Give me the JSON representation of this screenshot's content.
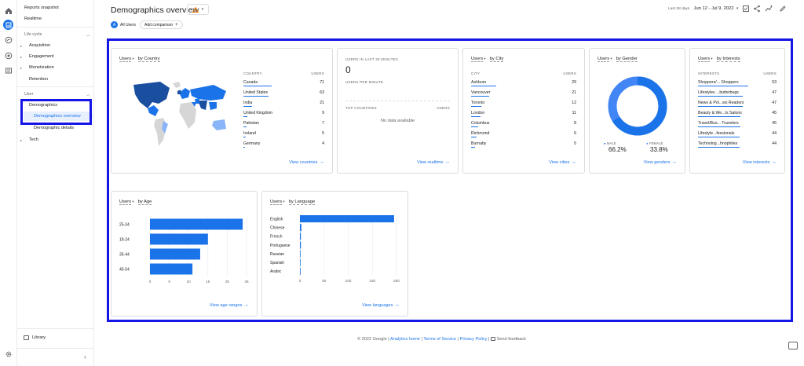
{
  "sidebar": {
    "reports_snapshot": "Reports snapshot",
    "realtime": "Realtime",
    "lifecycle_head": "Life cycle",
    "acquisition": "Acquisition",
    "engagement": "Engagement",
    "monetization": "Monetization",
    "retention": "Retention",
    "user_head": "User",
    "demographics": "Demographics",
    "demographics_overview": "Demographics overview",
    "demographic_details": "Demographic details",
    "tech": "Tech",
    "library": "Library"
  },
  "header": {
    "title": "Demographics overview",
    "date_label": "Last 28 days",
    "date_range": "Jun 12 - Jul 9, 2022",
    "all_users": "All Users",
    "all_users_avatar": "A",
    "add_comparison": "Add comparison"
  },
  "country_card": {
    "metric": "Users",
    "dimension": "by Country",
    "col_dim": "COUNTRY",
    "col_metric": "USERS",
    "rows": [
      {
        "label": "Canada",
        "value": "71",
        "share": 1.0
      },
      {
        "label": "United States",
        "value": "63",
        "share": 0.89
      },
      {
        "label": "India",
        "value": "21",
        "share": 0.3
      },
      {
        "label": "United Kingdom",
        "value": "9",
        "share": 0.13
      },
      {
        "label": "Pakistan",
        "value": "7",
        "share": 0.1
      },
      {
        "label": "Ireland",
        "value": "5",
        "share": 0.07
      },
      {
        "label": "Germany",
        "value": "4",
        "share": 0.06
      }
    ],
    "link": "View countries"
  },
  "realtime_card": {
    "head": "USERS IN LAST 30 MINUTES",
    "value": "0",
    "per_minute": "USERS PER MINUTE",
    "col_dim": "TOP COUNTRIES",
    "col_metric": "USERS",
    "empty": "No data available",
    "link": "View realtime"
  },
  "city_card": {
    "metric": "Users",
    "dimension": "by City",
    "col_dim": "CITY",
    "col_metric": "USERS",
    "rows": [
      {
        "label": "Ashburn",
        "value": "29",
        "share": 1.0
      },
      {
        "label": "Vancouver",
        "value": "21",
        "share": 0.72
      },
      {
        "label": "Toronto",
        "value": "12",
        "share": 0.41
      },
      {
        "label": "London",
        "value": "11",
        "share": 0.38
      },
      {
        "label": "Columbus",
        "value": "8",
        "share": 0.28
      },
      {
        "label": "Richmond",
        "value": "6",
        "share": 0.21
      },
      {
        "label": "Burnaby",
        "value": "5",
        "share": 0.17
      }
    ],
    "link": "View cities"
  },
  "gender_card": {
    "metric": "Users",
    "dimension": "by Gender",
    "male_label": "MALE",
    "male_value": "66.2%",
    "female_label": "FEMALE",
    "female_value": "33.8%",
    "male_color": "#1a73e8",
    "female_color": "#4285f4",
    "link": "View genders"
  },
  "interests_card": {
    "metric": "Users",
    "dimension": "by Interests",
    "col_dim": "INTERESTS",
    "col_metric": "USERS",
    "rows": [
      {
        "label": "Shoppers/... Shoppers",
        "value": "53",
        "share": 1.0
      },
      {
        "label": "Lifestyles ...butterbugs",
        "value": "47",
        "share": 0.89
      },
      {
        "label": "News & Pol...ws Readers",
        "value": "47",
        "share": 0.89
      },
      {
        "label": "Beauty & We...ts Salons",
        "value": "45",
        "share": 0.85
      },
      {
        "label": "Travel/Bus... Travelers",
        "value": "45",
        "share": 0.85
      },
      {
        "label": "Lifestyle...fessionals",
        "value": "44",
        "share": 0.83
      },
      {
        "label": "Technolog...hnophiles",
        "value": "44",
        "share": 0.83
      }
    ],
    "link": "View interests"
  },
  "age_card": {
    "metric": "Users",
    "dimension": "by Age",
    "link": "View age ranges"
  },
  "language_card": {
    "metric": "Users",
    "dimension": "by Language",
    "link": "View languages"
  },
  "chart_data": [
    {
      "type": "bar",
      "orientation": "horizontal",
      "categories": [
        "25-34",
        "18-24",
        "35-44",
        "45-54"
      ],
      "values": [
        24,
        15,
        13,
        11
      ],
      "xlim": [
        0,
        25
      ],
      "xticks": [
        "0",
        "5",
        "10",
        "15",
        "20",
        "25"
      ],
      "color": "#1a73e8"
    },
    {
      "type": "bar",
      "orientation": "horizontal",
      "categories": [
        "English",
        "Chinese",
        "French",
        "Portuguese",
        "Russian",
        "Spanish",
        "Arabic"
      ],
      "values": [
        195,
        3,
        2,
        2,
        1,
        1,
        1
      ],
      "xlim": [
        0,
        200
      ],
      "xticks": [
        "0",
        "50",
        "100",
        "150",
        "200"
      ],
      "color": "#1a73e8"
    }
  ],
  "footer": {
    "copyright": "© 2022 Google |",
    "analytics_home": "Analytics home",
    "sep1": "|",
    "terms": "Terms of Service",
    "sep2": "|",
    "privacy": "Privacy Policy",
    "sep3": "|",
    "feedback": "Send feedback"
  },
  "colors": {
    "accent": "#1a73e8",
    "highlight_frame": "#1515e6",
    "active_bg": "#e8f0fe"
  }
}
